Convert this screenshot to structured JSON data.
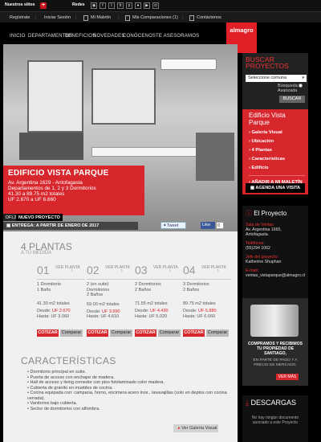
{
  "top_strip": {
    "nuestros_sitios": "Nuestros sitios",
    "plus": "+",
    "redes": "Redes",
    "social_icons": [
      "rss-icon",
      "facebook-icon",
      "twitter-icon",
      "blog-icon",
      "pinterest-icon",
      "flickr-icon",
      "youtube-icon",
      "instagram-icon"
    ]
  },
  "user_nav": {
    "registrate": "Regístrate",
    "iniciar": "Iniciar Sesión",
    "maletin": "Mi Maletín",
    "comparaciones": "Mis Comparaciones (1)",
    "contactenos": "Contáctenos"
  },
  "main_nav": [
    "INICIO",
    "DEPARTAMENTOS",
    "BENEFICIOS",
    "NOVEDADES",
    "CONÓCENOS",
    "TE ASESORAMOS"
  ],
  "logo": "almagro",
  "hero": {
    "title": "EDIFICIO VISTA PARQUE",
    "lines": [
      "Av. Argentina 1629 - Antofagasta",
      "Departamentos de 1, 2 y 3 Dormitorios",
      "41.30 a 89.75 m2 totales",
      "UF 2.670 a UF 6.660"
    ],
    "dfl2": "DFL2",
    "nuevo": "NUEVO PROYECTO",
    "entrega": "ENTREGA: A PARTIR DE ENERO DE 2017",
    "tweet": "Tweet",
    "like": "Like",
    "like_count": "0"
  },
  "buscar": {
    "title_line1": "BUSCAR",
    "title_line2": "PROYECTOS",
    "select_value": "Seleccione comuna",
    "busqueda": "Búsqueda",
    "avanzada": "Avanzada",
    "button": "BUSCAR"
  },
  "ficha": {
    "title_line1": "Edificio Vista",
    "title_line2": "Parque",
    "items": [
      "Galería Visual",
      "Ubicación",
      "4 Plantas",
      "Características",
      "Edificio"
    ],
    "agregar": "AÑADIR A MI MALETÍN 0",
    "agenda": "AGENDA UNA VISITA"
  },
  "proyecto": {
    "title": "El Proyecto",
    "sala_lbl": "Sala de Ventas",
    "sala_val": "Av. Argentina 1665, Antofagasta.",
    "tel_lbl": "Teléfonos:",
    "tel_val": "(55)294 1062",
    "jefe_lbl": "Jefe del proyecto:",
    "jefe_val": "Katherine Shuphan",
    "email_lbl": "E-mail:",
    "email_val": "ventas_vistaparque@almagro.cl"
  },
  "keys_ad": {
    "headline": "COMPRAMOS Y RECIBIMOS TU PROPIEDAD DE SANTIAGO,",
    "subline": "EN PARTE DE PAGO Y A PRECIO DE MERCADO.",
    "button": "VER MÁS"
  },
  "descargas": {
    "title": "DESCARGAS",
    "text": "No hay ningún documento asociado a este Proyecto"
  },
  "plantas": {
    "title": "4 PLANTAS",
    "subtitle": "A TU MEDIDA",
    "ver_planta": "VER PLANTA",
    "desde_label": "Desde:",
    "hasta_label": "Hasta:",
    "cotizar": "COTIZAR",
    "comparar": "Comparar",
    "items": [
      {
        "num": "01",
        "l1": "1 Dormitorio",
        "l2": "1 Baño",
        "area": "41.30 m2 totales",
        "desde": "UF 2.670",
        "hasta": "UF 3.060"
      },
      {
        "num": "02",
        "l1": "2 (en suite)",
        "l2": "Dormitorios",
        "l3": "2 Baños",
        "area": "59.00 m2 totales",
        "desde": "UF 3.990",
        "hasta": "UF 4.610"
      },
      {
        "num": "03",
        "l1": "2 Dormitorios",
        "l2": "2 Baños",
        "area": "71.55 m2 totales",
        "desde": "UF 4.430",
        "hasta": "UF 5.020"
      },
      {
        "num": "04",
        "l1": "3 Dormitorios",
        "l2": "2 Baños",
        "area": "89.75 m2 totales",
        "desde": "UF 5.880",
        "hasta": "UF 6.660"
      }
    ]
  },
  "caracteristicas": {
    "title": "CARACTERÍSTICAS",
    "items": [
      "Dormitorio principal en suite.",
      "Puerta de acceso con enchape de madera.",
      "Hall de acceso y living comedor con piso fotolaminado color madera.",
      "Cubierta de granito en muebles de cocina.",
      "Cocina equipada con: campana, horno, encimera acero inox., lavavajillas (solo en deptos con cocina cerrada).",
      "Vanitorios bajo cubierta.",
      "Sector de dormitorios con alfombra."
    ],
    "galeria": "Ver Galería Visual"
  }
}
